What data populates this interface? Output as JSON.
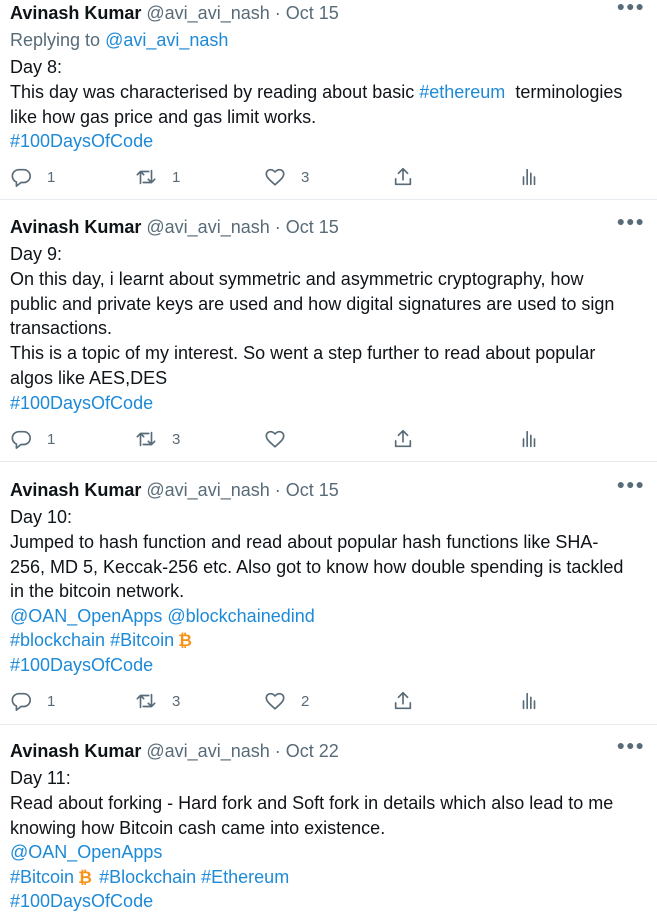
{
  "tweets": [
    {
      "author": "Avinash Kumar",
      "handle": "@avi_avi_nash",
      "sep": "·",
      "date": "Oct 15",
      "replying_prefix": "Replying to",
      "replying_handle": "@avi_avi_nash",
      "lines": [
        "Day 8:",
        "This day was characterised by reading about basic",
        "#ethereum",
        "terminologies",
        "like how gas price and gas limit works.",
        "#100DaysOfCode"
      ],
      "replies": "1",
      "retweets": "1",
      "likes": "3"
    },
    {
      "author": "Avinash Kumar",
      "handle": "@avi_avi_nash",
      "sep": "·",
      "date": "Oct 15",
      "lines": [
        "Day 9:",
        "On this day, i learnt about symmetric and asymmetric  cryptography, how",
        "public and private keys are used and how digital signatures are used to sign",
        "transactions.",
        "This is a topic of my interest. So went a step further to read about popular",
        "algos like AES,DES",
        "#100DaysOfCode"
      ],
      "replies": "1",
      "retweets": "3",
      "likes": ""
    },
    {
      "author": "Avinash Kumar",
      "handle": "@avi_avi_nash",
      "sep": "·",
      "date": "Oct 15",
      "lines": [
        "Day 10:",
        "Jumped to hash function and read about popular hash functions like SHA-",
        "256, MD 5, Keccak-256 etc. Also got to know how double spending is tackled",
        "in the bitcoin network.",
        "@OAN_OpenApps",
        "@blockchainedind",
        "#blockchain",
        "#Bitcoin",
        "#100DaysOfCode"
      ],
      "replies": "1",
      "retweets": "3",
      "likes": "2"
    },
    {
      "author": "Avinash Kumar",
      "handle": "@avi_avi_nash",
      "sep": "·",
      "date": "Oct 22",
      "lines": [
        "Day 11:",
        "Read about forking - Hard fork and Soft fork in details which also lead to me",
        "knowing how Bitcoin cash came into existence.",
        "@OAN_OpenApps",
        "#Bitcoin",
        "#Blockchain",
        "#Ethereum",
        "#100DaysOfCode"
      ]
    }
  ],
  "colors": {
    "link": "#1d8ad8",
    "meta": "#586b78",
    "bitcoin": "#f7931a"
  },
  "icons": [
    "more-icon",
    "reply-icon",
    "retweet-icon",
    "like-icon",
    "share-icon",
    "analytics-icon",
    "bitcoin-icon"
  ]
}
